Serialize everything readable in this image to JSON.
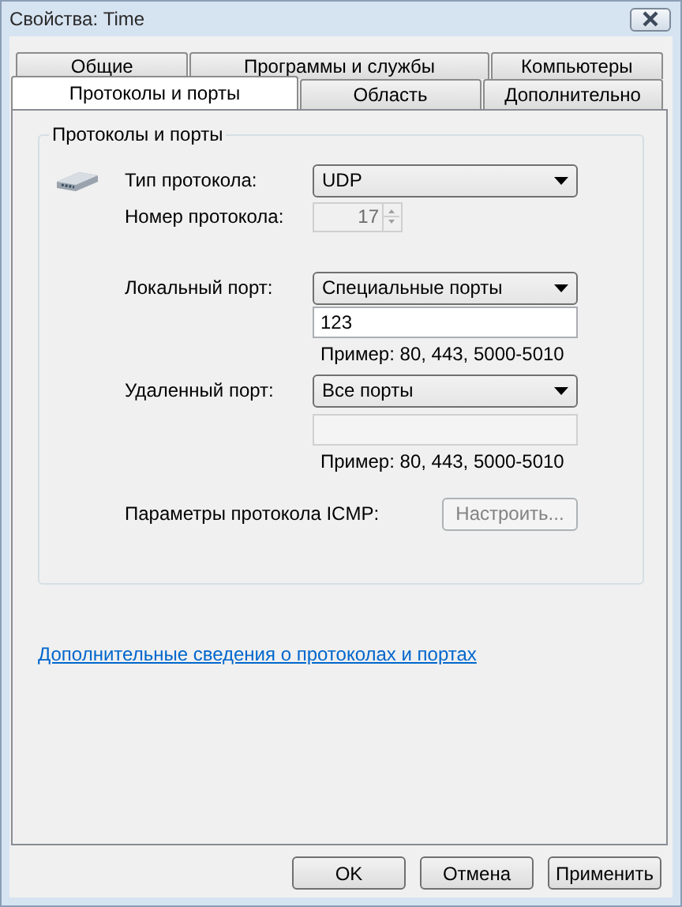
{
  "window": {
    "title": "Свойства: Time"
  },
  "tab_rows": [
    [
      {
        "label": "Общие",
        "selected": false
      },
      {
        "label": "Программы и службы",
        "selected": false
      },
      {
        "label": "Компьютеры",
        "selected": false
      }
    ],
    [
      {
        "label": "Протоколы и порты",
        "selected": true
      },
      {
        "label": "Область",
        "selected": false
      },
      {
        "label": "Дополнительно",
        "selected": false
      }
    ]
  ],
  "group": {
    "title": "Протоколы и порты",
    "protocol_type": {
      "label": "Тип протокола:",
      "value": "UDP"
    },
    "protocol_number": {
      "label": "Номер протокола:",
      "value": "17",
      "disabled": true
    },
    "local_port": {
      "label": "Локальный порт:",
      "value": "Специальные порты",
      "field_value": "123",
      "field_disabled": false,
      "hint": "Пример: 80, 443, 5000-5010"
    },
    "remote_port": {
      "label": "Удаленный порт:",
      "value": "Все порты",
      "field_disabled": true,
      "hint": "Пример: 80, 443, 5000-5010"
    },
    "icmp": {
      "label": "Параметры протокола ICMP:",
      "button": "Настроить...",
      "disabled": true
    }
  },
  "link": "Дополнительные сведения о протоколах и портах",
  "buttons": [
    "OK",
    "Отмена",
    "Применить"
  ]
}
